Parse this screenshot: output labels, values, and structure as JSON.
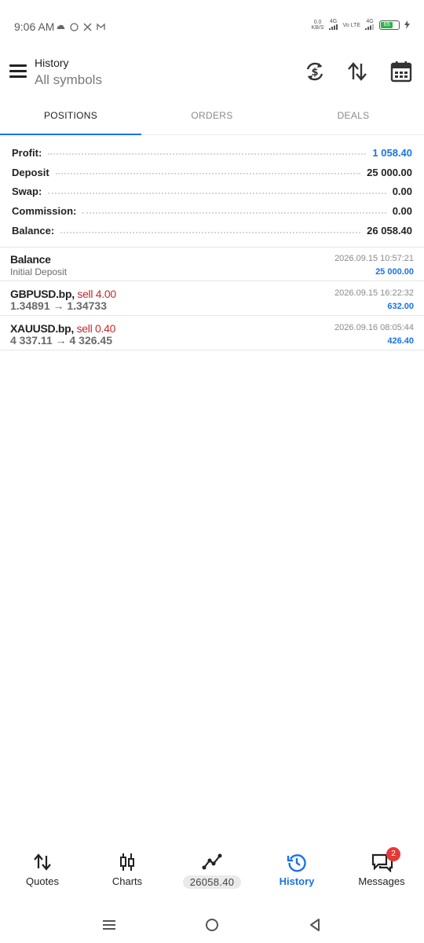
{
  "status_bar": {
    "time": "9:06 AM",
    "battery": "65",
    "data_speed": "0.0",
    "data_unit": "KB/S",
    "net1": "4G",
    "net2": "Vo LTE",
    "net3": "4G"
  },
  "header": {
    "title": "History",
    "subtitle": "All symbols",
    "icons": [
      "menu-icon",
      "currency-refresh-icon",
      "sort-icon",
      "calendar-icon"
    ]
  },
  "tabs": [
    {
      "label": "POSITIONS",
      "active": true
    },
    {
      "label": "ORDERS",
      "active": false
    },
    {
      "label": "DEALS",
      "active": false
    }
  ],
  "summary": {
    "profit_label": "Profit:",
    "profit_value": "1 058.40",
    "deposit_label": "Deposit",
    "deposit_value": "25 000.00",
    "swap_label": "Swap:",
    "swap_value": "0.00",
    "commission_label": "Commission:",
    "commission_value": "0.00",
    "balance_label": "Balance:",
    "balance_value": "26 058.40"
  },
  "deals": [
    {
      "symbol": "Balance",
      "side": "",
      "detail": "Initial Deposit",
      "time": "2026.09.15 10:57:21",
      "amount": "25 000.00"
    },
    {
      "symbol": "GBPUSD.bp,",
      "side": "sell 4.00",
      "detail": "1.34891 → 1.34733",
      "time": "2026.09.15 16:22:32",
      "amount": "632.00"
    },
    {
      "symbol": "XAUUSD.bp,",
      "side": "sell 0.40",
      "detail": "4 337.11 → 4 326.45",
      "time": "2026.09.16 08:05:44",
      "amount": "426.40"
    }
  ],
  "bottom_nav": {
    "quotes": "Quotes",
    "charts": "Charts",
    "trade_balance": "26058.40",
    "history": "History",
    "messages": "Messages",
    "messages_badge": "2"
  },
  "colors": {
    "accent": "#1a73e8",
    "sell": "#c62828",
    "badge": "#e53935"
  }
}
